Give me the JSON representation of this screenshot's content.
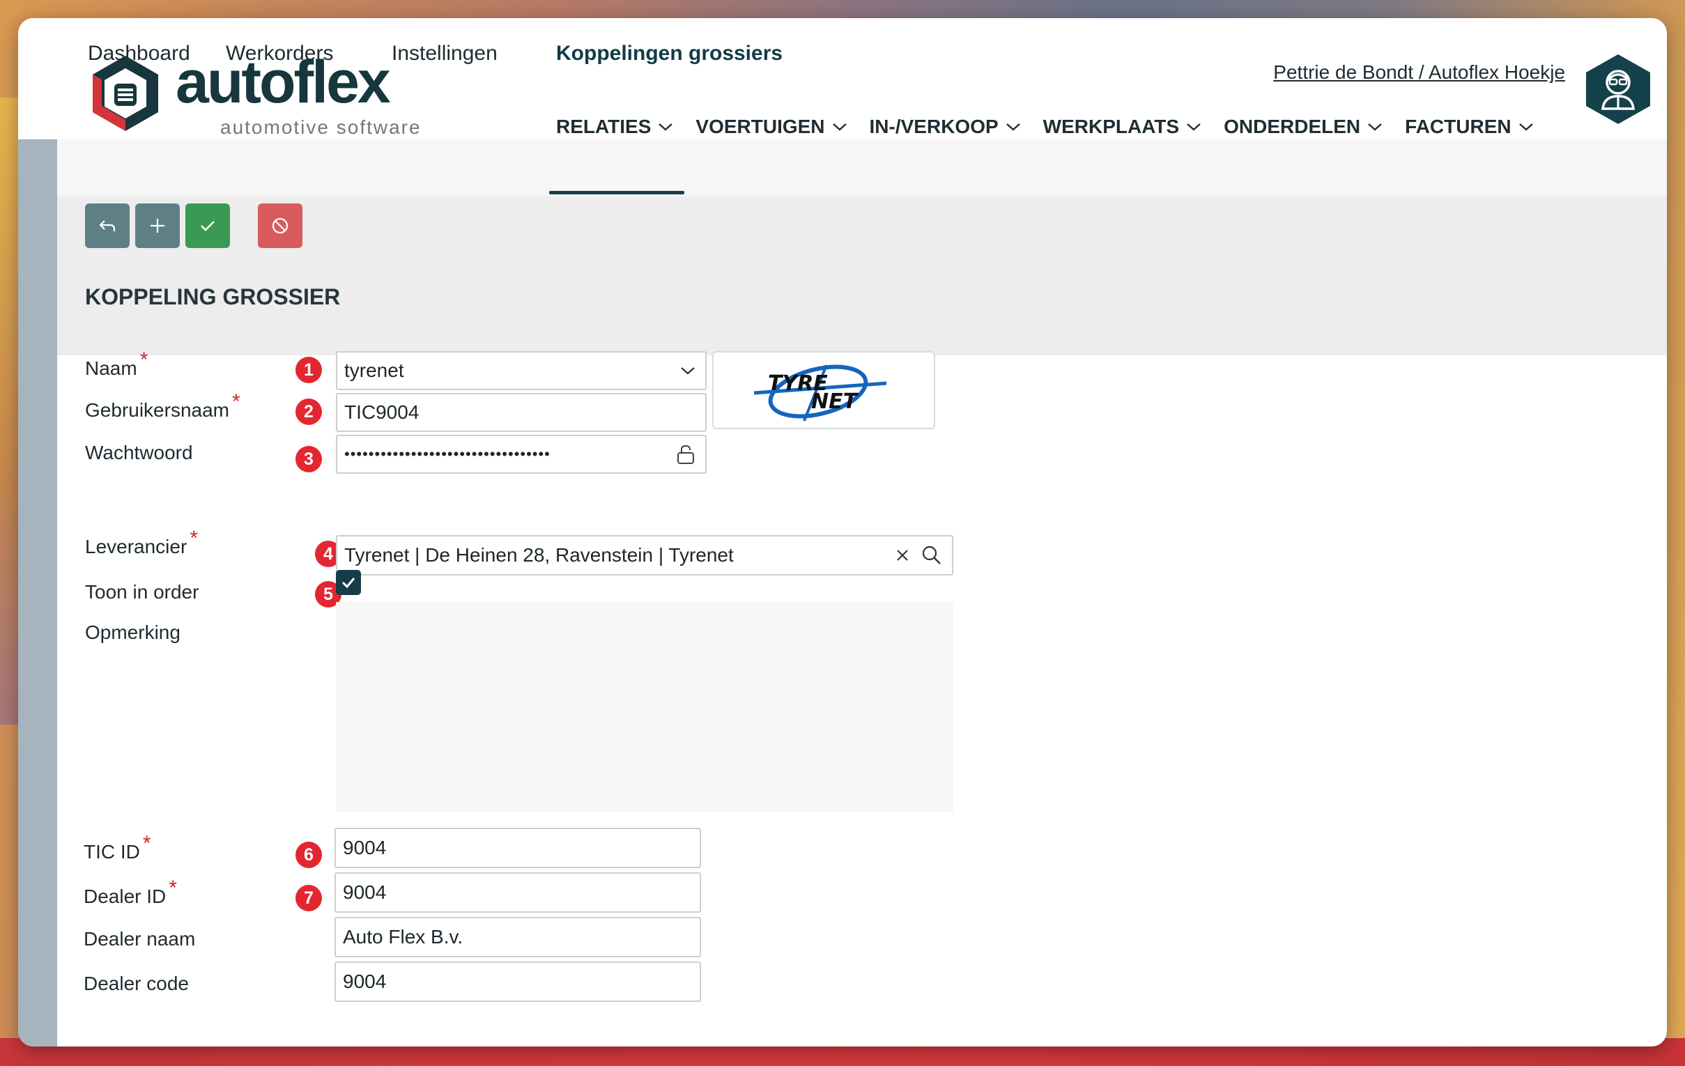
{
  "app": {
    "logo_text": "autoflex",
    "logo_subtitle": "automotive software",
    "user_link": "Pettrie de Bondt / Autoflex Hoekje"
  },
  "top_nav": [
    {
      "label": "RELATIES"
    },
    {
      "label": "VOERTUIGEN"
    },
    {
      "label": "IN-/VERKOOP"
    },
    {
      "label": "WERKPLAATS"
    },
    {
      "label": "ONDERDELEN"
    },
    {
      "label": "FACTUREN"
    }
  ],
  "sub_tabs": [
    {
      "label": "Dashboard",
      "active": false
    },
    {
      "label": "Werkorders",
      "active": false
    },
    {
      "label": "Instellingen",
      "active": false
    },
    {
      "label": "Koppelingen grossiers",
      "active": true
    }
  ],
  "toolbar": {
    "buttons": [
      {
        "icon": "undo-icon",
        "color": "#5f7f87"
      },
      {
        "icon": "plus-icon",
        "color": "#5f7f87"
      },
      {
        "icon": "check-icon",
        "color": "#3a9a55"
      },
      {
        "icon": "block-icon",
        "color": "#d95b5b"
      }
    ]
  },
  "section_title": "KOPPELING GROSSIER",
  "required_marker": "*",
  "form": {
    "naam": {
      "label": "Naam",
      "value": "tyrenet",
      "badge": "1"
    },
    "gebruikersnaam": {
      "label": "Gebruikersnaam",
      "value": "TIC9004",
      "badge": "2"
    },
    "wachtwoord": {
      "label": "Wachtwoord",
      "value": "••••••••••••••••••••••••••••••••••",
      "badge": "3"
    },
    "leverancier": {
      "label": "Leverancier",
      "value": "Tyrenet | De Heinen 28, Ravenstein | Tyrenet",
      "badge": "4"
    },
    "toon_in_order": {
      "label": "Toon in order",
      "checked": true,
      "badge": "5"
    },
    "opmerking": {
      "label": "Opmerking",
      "value": ""
    },
    "tic_id": {
      "label": "TIC ID",
      "value": "9004",
      "badge": "6"
    },
    "dealer_id": {
      "label": "Dealer ID",
      "value": "9004",
      "badge": "7"
    },
    "dealer_naam": {
      "label": "Dealer naam",
      "value": "Auto Flex B.v."
    },
    "dealer_code": {
      "label": "Dealer code",
      "value": "9004"
    }
  },
  "supplier_logo": {
    "line1": "TYRE",
    "line2": "NET"
  },
  "colors": {
    "brand_dark": "#17363d",
    "brand_red": "#d4343a",
    "badge_red": "#e3262f",
    "checkbox": "#173c45"
  }
}
